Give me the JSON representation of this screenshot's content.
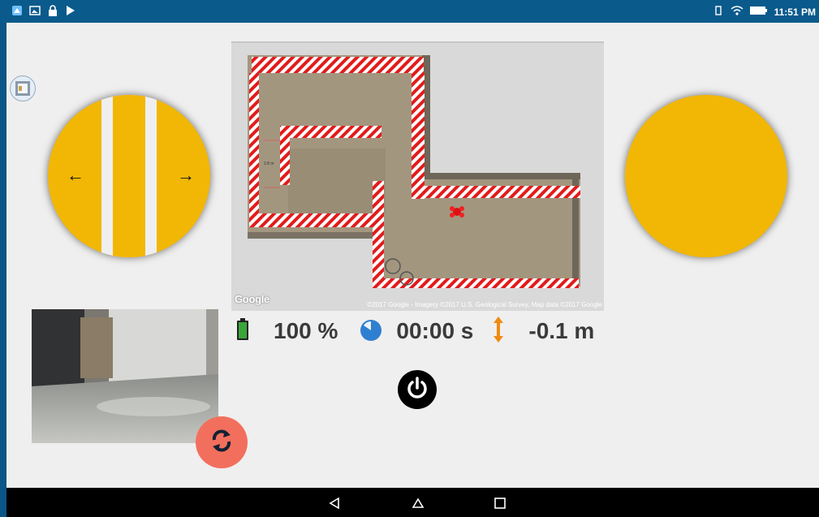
{
  "status_bar": {
    "time": "11:51 PM",
    "left_icons": [
      "app-icon",
      "gallery-icon",
      "lock-icon",
      "play-store-icon"
    ],
    "right_icons": [
      "vibrate-icon",
      "wifi-icon",
      "battery-icon"
    ]
  },
  "map": {
    "logo": "Google",
    "attribution": "©2017 Google - Imagery ©2017 U.S. Geological Survey, Map data ©2017 Google",
    "scale_label": "2.8 m"
  },
  "stats": {
    "battery": "100 %",
    "flight_time": "00:00 s",
    "altitude": "-0.1 m"
  },
  "joystick_left": {
    "left_arrow": "←",
    "right_arrow": "→"
  },
  "icons": {
    "battery": "battery-icon",
    "timer": "timer-icon",
    "altitude": "altitude-icon",
    "power": "power-icon",
    "swap": "swap-camera-icon",
    "drone": "drone-marker-icon"
  },
  "colors": {
    "joystick": "#f2b705",
    "swap_button": "#f36f5d",
    "battery": "#3aa63a",
    "timer": "#2f7fd0",
    "altitude": "#f08a10",
    "status_bar": "#0a5a8c"
  }
}
